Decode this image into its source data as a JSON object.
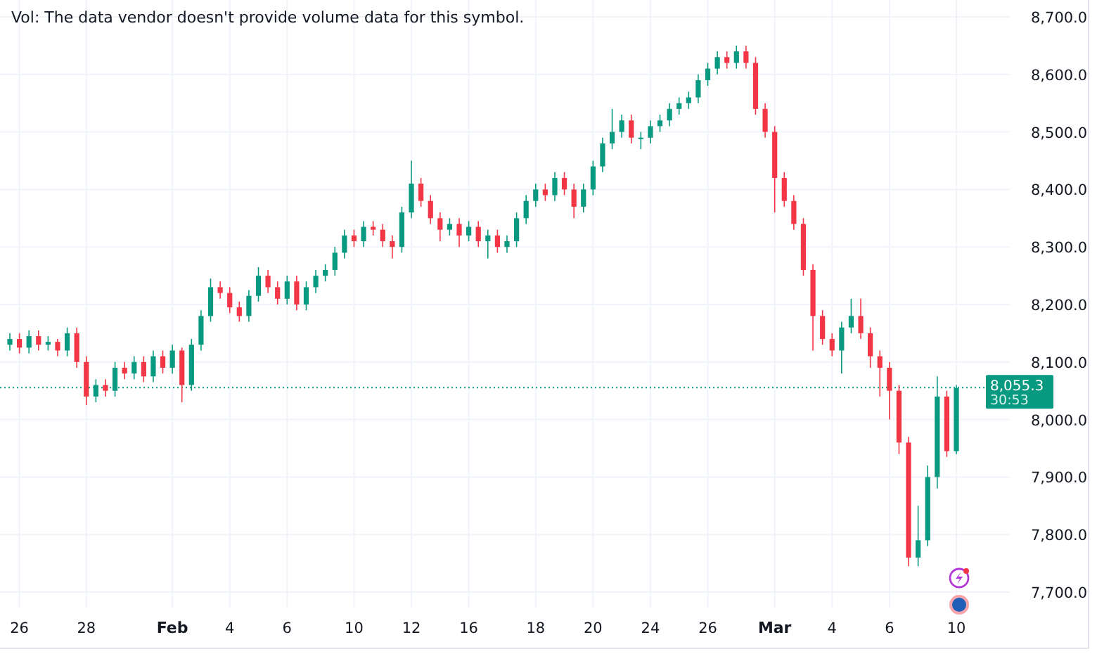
{
  "legend": {
    "volume_note": "Vol: The data vendor doesn't provide volume data for this symbol."
  },
  "chart": {
    "x_label_bold": [
      false,
      false,
      true,
      false,
      false,
      false,
      false,
      false,
      false,
      false,
      false,
      false,
      true,
      false,
      false,
      false
    ],
    "chart_data": {
      "type": "candlestick",
      "grid": true,
      "ylim": [
        7700,
        8700
      ],
      "ref_lines": [
        {
          "axis": "y",
          "value": 8055.3,
          "color": "#089981"
        }
      ],
      "categories": [
        null,
        "26",
        null,
        null,
        null,
        null,
        null,
        null,
        "28",
        null,
        null,
        null,
        null,
        null,
        null,
        null,
        null,
        "Feb",
        null,
        null,
        null,
        null,
        null,
        "4",
        null,
        null,
        null,
        null,
        null,
        "6",
        null,
        null,
        null,
        null,
        null,
        null,
        "10",
        null,
        null,
        null,
        null,
        null,
        "12",
        null,
        null,
        null,
        null,
        null,
        "16",
        null,
        null,
        null,
        null,
        null,
        null,
        "18",
        null,
        null,
        null,
        null,
        null,
        "20",
        null,
        null,
        null,
        null,
        null,
        "24",
        null,
        null,
        null,
        null,
        null,
        "26",
        null,
        null,
        null,
        null,
        null,
        null,
        "Mar",
        null,
        null,
        null,
        null,
        null,
        "4",
        null,
        null,
        null,
        null,
        null,
        "6",
        null,
        null,
        null,
        null,
        null,
        null,
        "10"
      ],
      "yticks": [
        {
          "value": 8700,
          "label": "8,700.0"
        },
        {
          "value": 8600,
          "label": "8,600.0"
        },
        {
          "value": 8500,
          "label": "8,500.0"
        },
        {
          "value": 8400,
          "label": "8,400.0"
        },
        {
          "value": 8300,
          "label": "8,300.0"
        },
        {
          "value": 8200,
          "label": "8,200.0"
        },
        {
          "value": 8100,
          "label": "8,100.0"
        },
        {
          "value": 8000,
          "label": "8,000.0"
        },
        {
          "value": 7900,
          "label": "7,900.0"
        },
        {
          "value": 7800,
          "label": "7,800.0"
        },
        {
          "value": 7700,
          "label": "7,700.0"
        }
      ],
      "ohlc": [
        [
          8130,
          8150,
          8120,
          8140
        ],
        [
          8140,
          8150,
          8115,
          8125
        ],
        [
          8125,
          8155,
          8115,
          8145
        ],
        [
          8145,
          8155,
          8120,
          8130
        ],
        [
          8130,
          8145,
          8120,
          8135
        ],
        [
          8135,
          8140,
          8110,
          8120
        ],
        [
          8120,
          8160,
          8110,
          8150
        ],
        [
          8150,
          8160,
          8090,
          8100
        ],
        [
          8100,
          8110,
          8025,
          8040
        ],
        [
          8040,
          8070,
          8030,
          8060
        ],
        [
          8060,
          8070,
          8040,
          8050
        ],
        [
          8050,
          8100,
          8040,
          8090
        ],
        [
          8090,
          8100,
          8070,
          8080
        ],
        [
          8080,
          8110,
          8070,
          8100
        ],
        [
          8100,
          8110,
          8065,
          8075
        ],
        [
          8075,
          8120,
          8065,
          8110
        ],
        [
          8110,
          8120,
          8080,
          8090
        ],
        [
          8090,
          8130,
          8080,
          8120
        ],
        [
          8120,
          8125,
          8030,
          8060
        ],
        [
          8060,
          8140,
          8050,
          8130
        ],
        [
          8130,
          8190,
          8120,
          8180
        ],
        [
          8180,
          8245,
          8170,
          8230
        ],
        [
          8230,
          8240,
          8210,
          8220
        ],
        [
          8220,
          8230,
          8185,
          8195
        ],
        [
          8195,
          8205,
          8170,
          8180
        ],
        [
          8180,
          8225,
          8170,
          8215
        ],
        [
          8215,
          8265,
          8205,
          8250
        ],
        [
          8250,
          8260,
          8220,
          8230
        ],
        [
          8230,
          8240,
          8200,
          8210
        ],
        [
          8210,
          8250,
          8200,
          8240
        ],
        [
          8240,
          8250,
          8190,
          8200
        ],
        [
          8200,
          8240,
          8190,
          8230
        ],
        [
          8230,
          8260,
          8220,
          8250
        ],
        [
          8250,
          8270,
          8240,
          8260
        ],
        [
          8260,
          8300,
          8250,
          8290
        ],
        [
          8290,
          8330,
          8280,
          8320
        ],
        [
          8320,
          8330,
          8300,
          8310
        ],
        [
          8310,
          8345,
          8300,
          8335
        ],
        [
          8335,
          8345,
          8320,
          8330
        ],
        [
          8330,
          8340,
          8300,
          8310
        ],
        [
          8310,
          8320,
          8280,
          8300
        ],
        [
          8300,
          8370,
          8290,
          8360
        ],
        [
          8360,
          8450,
          8350,
          8410
        ],
        [
          8410,
          8420,
          8370,
          8380
        ],
        [
          8380,
          8390,
          8340,
          8350
        ],
        [
          8350,
          8360,
          8310,
          8330
        ],
        [
          8330,
          8350,
          8320,
          8340
        ],
        [
          8340,
          8350,
          8300,
          8320
        ],
        [
          8320,
          8345,
          8310,
          8335
        ],
        [
          8335,
          8345,
          8300,
          8310
        ],
        [
          8310,
          8330,
          8280,
          8320
        ],
        [
          8320,
          8330,
          8290,
          8300
        ],
        [
          8300,
          8320,
          8290,
          8310
        ],
        [
          8310,
          8360,
          8300,
          8350
        ],
        [
          8350,
          8390,
          8340,
          8380
        ],
        [
          8380,
          8410,
          8370,
          8400
        ],
        [
          8400,
          8410,
          8380,
          8390
        ],
        [
          8390,
          8430,
          8380,
          8420
        ],
        [
          8420,
          8430,
          8390,
          8400
        ],
        [
          8400,
          8410,
          8350,
          8370
        ],
        [
          8370,
          8410,
          8360,
          8400
        ],
        [
          8400,
          8450,
          8390,
          8440
        ],
        [
          8440,
          8490,
          8430,
          8480
        ],
        [
          8480,
          8540,
          8470,
          8500
        ],
        [
          8500,
          8530,
          8490,
          8520
        ],
        [
          8520,
          8530,
          8480,
          8490
        ],
        [
          8490,
          8500,
          8470,
          8490
        ],
        [
          8490,
          8520,
          8480,
          8510
        ],
        [
          8510,
          8530,
          8500,
          8520
        ],
        [
          8520,
          8550,
          8510,
          8540
        ],
        [
          8540,
          8560,
          8530,
          8550
        ],
        [
          8550,
          8570,
          8540,
          8560
        ],
        [
          8560,
          8600,
          8550,
          8590
        ],
        [
          8590,
          8620,
          8580,
          8610
        ],
        [
          8610,
          8640,
          8600,
          8630
        ],
        [
          8630,
          8640,
          8610,
          8620
        ],
        [
          8620,
          8650,
          8610,
          8640
        ],
        [
          8640,
          8650,
          8610,
          8620
        ],
        [
          8620,
          8630,
          8530,
          8540
        ],
        [
          8540,
          8550,
          8490,
          8500
        ],
        [
          8500,
          8510,
          8360,
          8420
        ],
        [
          8420,
          8430,
          8370,
          8380
        ],
        [
          8380,
          8390,
          8330,
          8340
        ],
        [
          8340,
          8350,
          8250,
          8260
        ],
        [
          8260,
          8270,
          8120,
          8180
        ],
        [
          8180,
          8190,
          8130,
          8140
        ],
        [
          8140,
          8150,
          8110,
          8120
        ],
        [
          8120,
          8170,
          8080,
          8160
        ],
        [
          8160,
          8210,
          8150,
          8180
        ],
        [
          8180,
          8210,
          8140,
          8150
        ],
        [
          8150,
          8160,
          8090,
          8110
        ],
        [
          8110,
          8120,
          8040,
          8090
        ],
        [
          8090,
          8100,
          8000,
          8050
        ],
        [
          8050,
          8060,
          7940,
          7960
        ],
        [
          7960,
          7970,
          7745,
          7760
        ],
        [
          7760,
          7850,
          7745,
          7790
        ],
        [
          7790,
          7920,
          7780,
          7900
        ],
        [
          7900,
          8075,
          7880,
          8040
        ],
        [
          8040,
          8050,
          7935,
          7945
        ],
        [
          7945,
          8060,
          7940,
          8055
        ]
      ]
    }
  },
  "last_price": {
    "value": "8,055.3",
    "countdown": "30:53"
  }
}
